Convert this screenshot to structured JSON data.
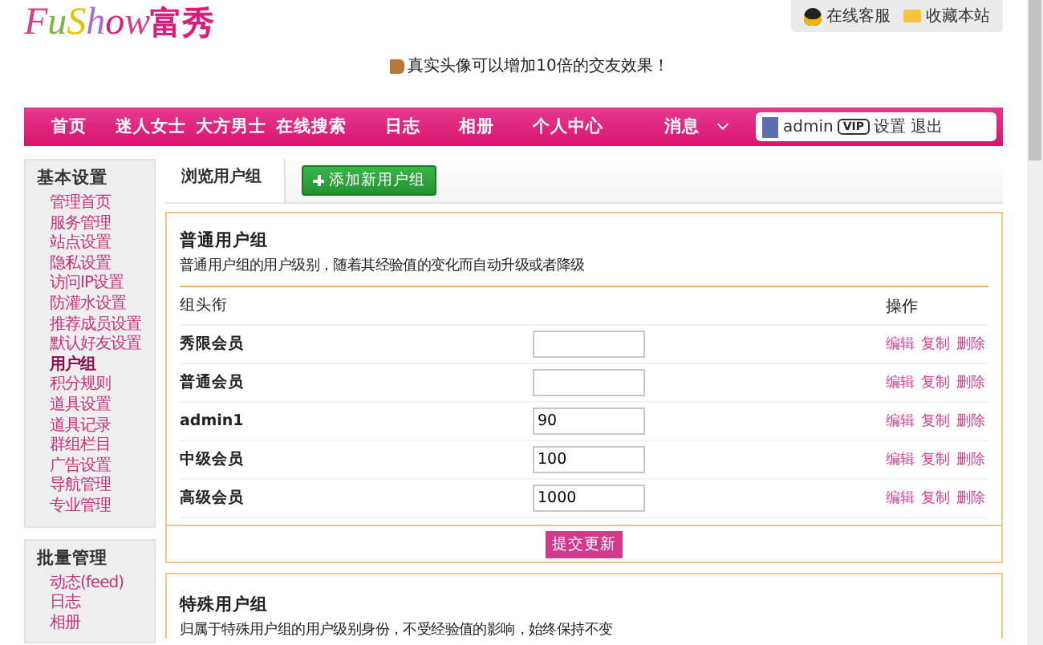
{
  "header": {
    "logo": {
      "latin": "FuShow",
      "cjk": "富秀"
    },
    "top_links": [
      {
        "kind": "qq",
        "label": "在线客服"
      },
      {
        "kind": "folder",
        "label": "收藏本站"
      }
    ],
    "notice": "真实头像可以增加10倍的交友效果！"
  },
  "nav": {
    "items": [
      {
        "label": "首页",
        "dropdown": false
      },
      {
        "label": "迷人女士",
        "dropdown": false
      },
      {
        "label": "大方男士",
        "dropdown": false
      },
      {
        "label": "在线搜索",
        "dropdown": false
      },
      {
        "label": "日志",
        "dropdown": false
      },
      {
        "label": "相册",
        "dropdown": false
      },
      {
        "label": "个人中心",
        "dropdown": false
      },
      {
        "label": "消息",
        "dropdown": true
      }
    ],
    "user": {
      "name": "admin",
      "badge": "VIP",
      "links": [
        "设置",
        "退出"
      ]
    }
  },
  "sidebar": [
    {
      "title": "基本设置",
      "items": [
        {
          "label": "管理首页",
          "selected": false
        },
        {
          "label": "服务管理",
          "selected": false
        },
        {
          "label": "站点设置",
          "selected": false
        },
        {
          "label": "隐私设置",
          "selected": false
        },
        {
          "label": "访问IP设置",
          "selected": false
        },
        {
          "label": "防灌水设置",
          "selected": false
        },
        {
          "label": "推荐成员设置",
          "selected": false
        },
        {
          "label": "默认好友设置",
          "selected": false
        },
        {
          "label": "用户组",
          "selected": true
        },
        {
          "label": "积分规则",
          "selected": false
        },
        {
          "label": "道具设置",
          "selected": false
        },
        {
          "label": "道具记录",
          "selected": false
        },
        {
          "label": "群组栏目",
          "selected": false
        },
        {
          "label": "广告设置",
          "selected": false
        },
        {
          "label": "导航管理",
          "selected": false
        },
        {
          "label": "专业管理",
          "selected": false
        }
      ]
    },
    {
      "title": "批量管理",
      "items": [
        {
          "label": "动态(feed)",
          "selected": false
        },
        {
          "label": "日志",
          "selected": false
        },
        {
          "label": "相册",
          "selected": false
        }
      ]
    }
  ],
  "tabs": [
    {
      "kind": "tab",
      "label": "浏览用户组",
      "selected": true
    },
    {
      "kind": "button",
      "label": "添加新用户组"
    }
  ],
  "normal_groups": {
    "title": "普通用户组",
    "description": "普通用户组的用户级别，随着其经验值的变化而自动升级或者降级",
    "columns": [
      "组头衔",
      "操作"
    ],
    "rows": [
      {
        "name": "秀限会员",
        "actions": [
          "编辑",
          "复制",
          "删除"
        ]
      },
      {
        "name": "普通会员",
        "actions": [
          "编辑",
          "复制",
          "删除"
        ]
      },
      {
        "name": "admin1",
        "value": "90",
        "actions": [
          "编辑",
          "复制",
          "删除"
        ]
      },
      {
        "name": "中级会员",
        "value": "100",
        "actions": [
          "编辑",
          "复制",
          "删除"
        ]
      },
      {
        "name": "高级会员",
        "value": "1000",
        "actions": [
          "编辑",
          "复制",
          "删除"
        ]
      }
    ],
    "submit": "提交更新"
  },
  "special_groups": {
    "title": "特殊用户组",
    "description": "归属于特殊用户组的用户级别身份，不受经验值的影响，始终保持不变"
  }
}
